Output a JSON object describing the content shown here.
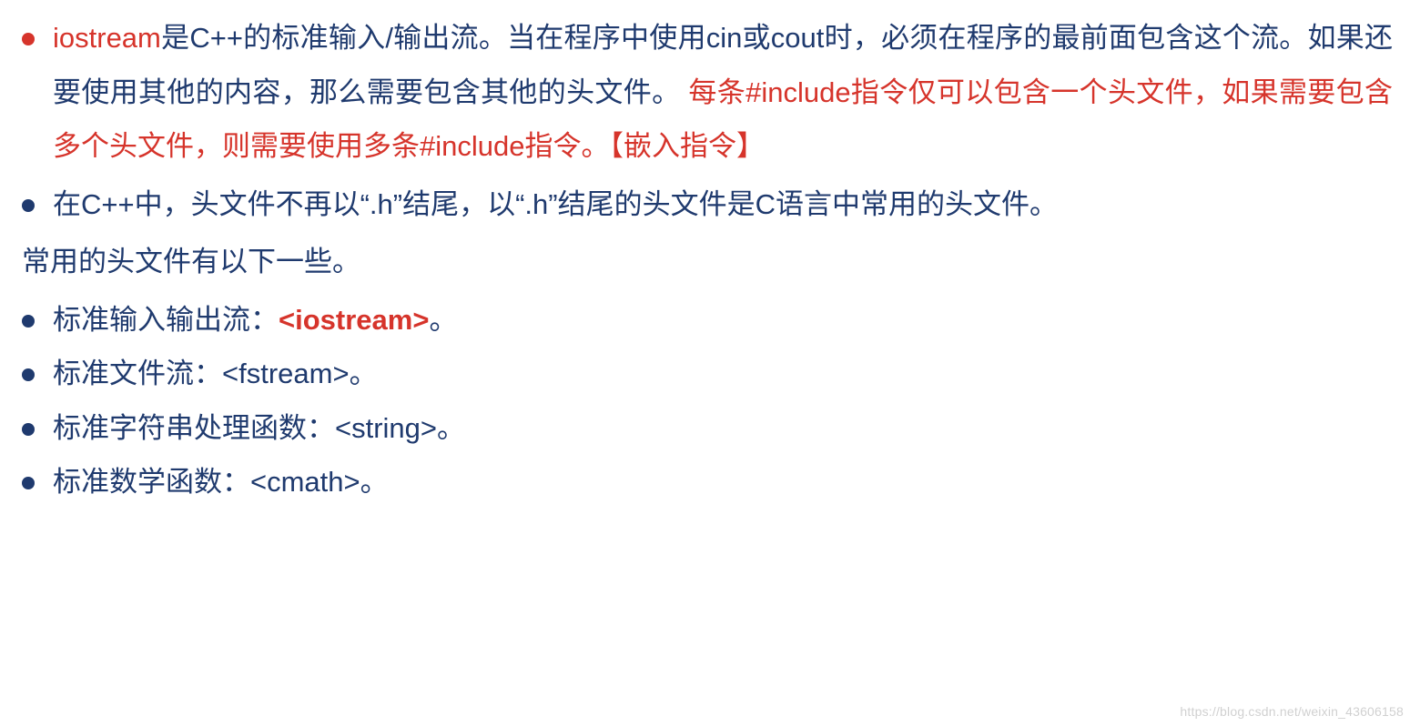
{
  "bullet1": {
    "p1_red": "iostream",
    "p1_blue": "是C++的标准输入/输出流。当在程序中使用cin或cout时，必须在程序的最前面包含这个流。如果还要使用其他的内容，那么需要包含其他的头文件。",
    "p2_red": "每条#include指令仅可以包含一个头文件，如果需要包含多个头文件，则需要使用多条#include指令。【嵌入指令】"
  },
  "bullet2": {
    "text": "在C++中，头文件不再以“.h”结尾，以“.h”结尾的头文件是C语言中常用的头文件。"
  },
  "plain_line": "常用的头文件有以下一些。",
  "headers": [
    {
      "prefix": "标准输入输出流：",
      "value": "<iostream>",
      "suffix": "。",
      "highlight": true
    },
    {
      "prefix": "标准文件流：",
      "value": "<fstream>",
      "suffix": "。",
      "highlight": false
    },
    {
      "prefix": "标准字符串处理函数：",
      "value": "<string>",
      "suffix": "。",
      "highlight": false
    },
    {
      "prefix": "标准数学函数：",
      "value": "<cmath>",
      "suffix": "。",
      "highlight": false
    }
  ],
  "watermark": "https://blog.csdn.net/weixin_43606158"
}
